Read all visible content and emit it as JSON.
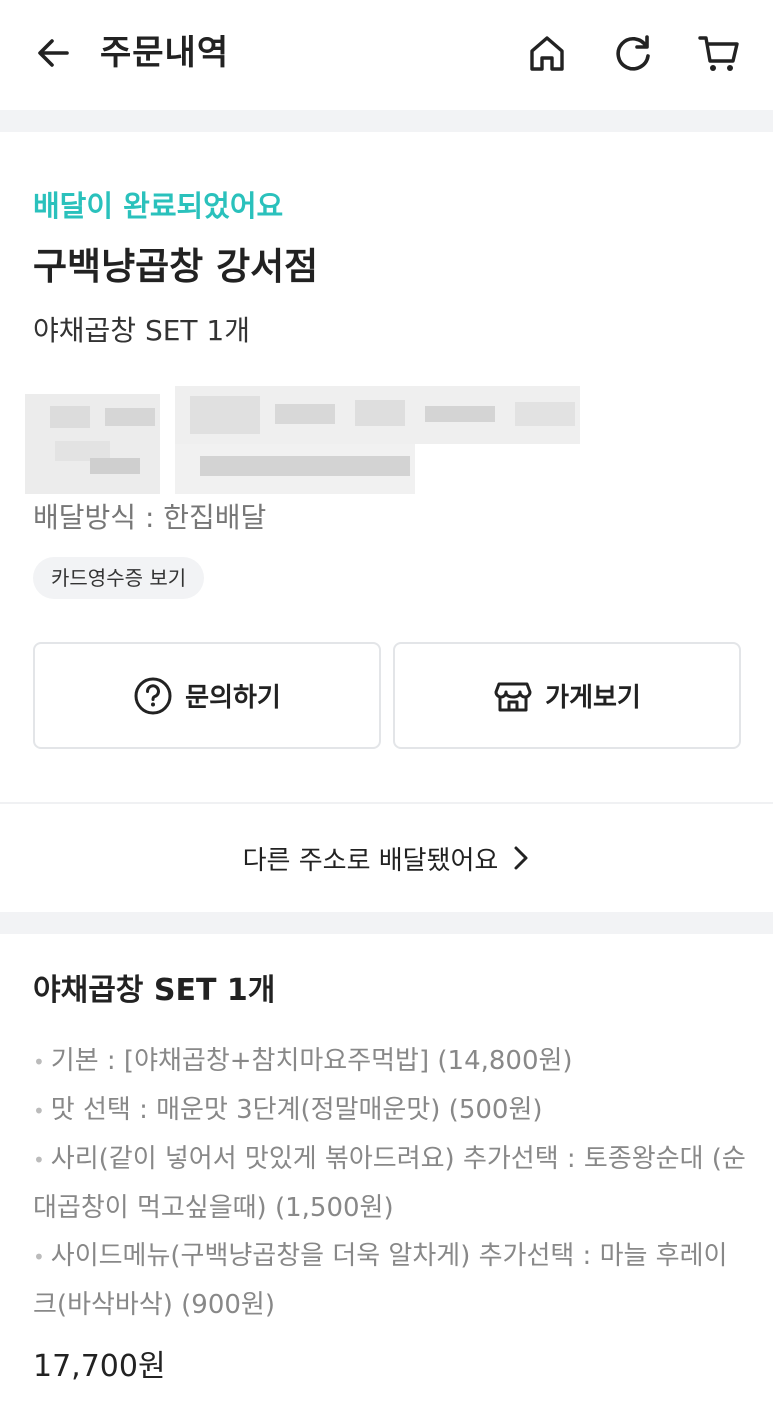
{
  "header": {
    "title": "주문내역",
    "icons": [
      "back-arrow-icon",
      "home-icon",
      "refresh-icon",
      "cart-icon"
    ]
  },
  "order": {
    "status": "배달이 완료되었어요",
    "store_name": "구백냥곱창 강서점",
    "summary": "야채곱창 SET 1개",
    "delivery_method": "배달방식 : 한집배달",
    "receipt_button": "카드영수증 보기"
  },
  "actions": {
    "inquiry_label": "문의하기",
    "store_label": "가게보기"
  },
  "address_link": {
    "label": "다른 주소로 배달됐어요"
  },
  "item": {
    "title": "야채곱창 SET 1개",
    "options": [
      "기본 : [야채곱창+참치마요주먹밥] (14,800원)",
      "맛 선택 : 매운맛 3단계(정말매운맛) (500원)",
      "사리(같이 넣어서 맛있게 볶아드려요) 추가선택 : 토종왕순대 (순대곱창이 먹고싶을때) (1,500원)",
      "사이드메뉴(구백냥곱창을 더욱 알차게) 추가선택 : 마늘 후레이크(바삭바삭) (900원)"
    ],
    "total": "17,700원"
  },
  "colors": {
    "accent": "#2ac1bc",
    "text": "#222222",
    "muted": "#888888",
    "section_gap": "#f2f3f5"
  }
}
